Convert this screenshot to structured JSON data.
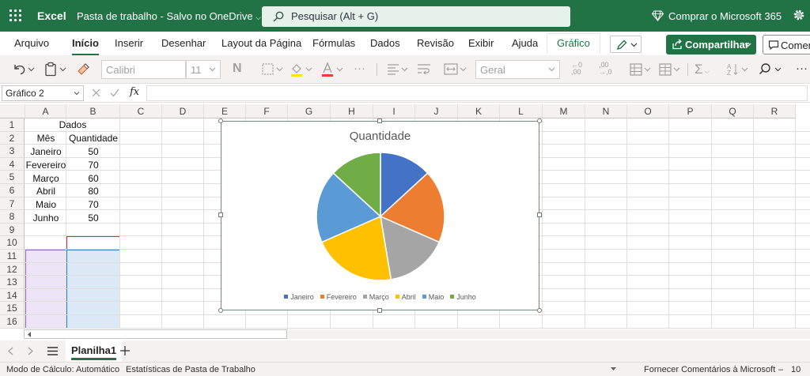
{
  "titlebar": {
    "app_name": "Excel",
    "doc_title": "Pasta de trabalho  -  Salvo no OneDrive",
    "search_placeholder": "Pesquisar (Alt + G)",
    "buy_label": "Comprar o Microsoft 365",
    "bg_color": "#217346"
  },
  "tabs": [
    "Arquivo",
    "Início",
    "Inserir",
    "Desenhar",
    "Layout da Página",
    "Fórmulas",
    "Dados",
    "Revisão",
    "Exibir",
    "Ajuda",
    "Gráfico"
  ],
  "active_tab": "Início",
  "share_label": "Compartilhar",
  "comment_label": "Comen",
  "toolbar": {
    "font_name": "Calibri",
    "font_size": "11",
    "number_format": "Geral"
  },
  "formula_bar": {
    "name_box": "Gráfico 2",
    "fx_label": "fx",
    "formula": ""
  },
  "columns": [
    "A",
    "B",
    "C",
    "D",
    "E",
    "F",
    "G",
    "H",
    "I",
    "J",
    "K",
    "L",
    "M",
    "N",
    "O",
    "P",
    "Q",
    "R"
  ],
  "rows": [
    "1",
    "2",
    "3",
    "4",
    "5",
    "6",
    "7",
    "8",
    "9",
    "10",
    "11",
    "12",
    "13",
    "14",
    "15",
    "16"
  ],
  "sheet": {
    "title_cell": "Dados",
    "headers": [
      "Mês",
      "Quantidade"
    ],
    "data": [
      [
        "Janeiro",
        "50"
      ],
      [
        "Fevereiro",
        "70"
      ],
      [
        "Março",
        "60"
      ],
      [
        "Abril",
        "80"
      ],
      [
        "Maio",
        "70"
      ],
      [
        "Junho",
        "50"
      ]
    ]
  },
  "chart_data": {
    "type": "pie",
    "title": "Quantidade",
    "categories": [
      "Janeiro",
      "Fevereiro",
      "Março",
      "Abril",
      "Maio",
      "Junho"
    ],
    "values": [
      50,
      70,
      60,
      80,
      70,
      50
    ],
    "colors": [
      "#4472c4",
      "#ed7d31",
      "#a5a5a5",
      "#ffc000",
      "#5b9bd5",
      "#70ad47"
    ],
    "legend_position": "bottom"
  },
  "sheet_tabs": [
    "Planilha1"
  ],
  "statusbar": {
    "calc_mode": "Modo de Cálculo: Automático",
    "stats": "Estatísticas de Pasta de Trabalho",
    "feedback": "Fornecer Comentários à Microsoft",
    "zoom": "10"
  }
}
